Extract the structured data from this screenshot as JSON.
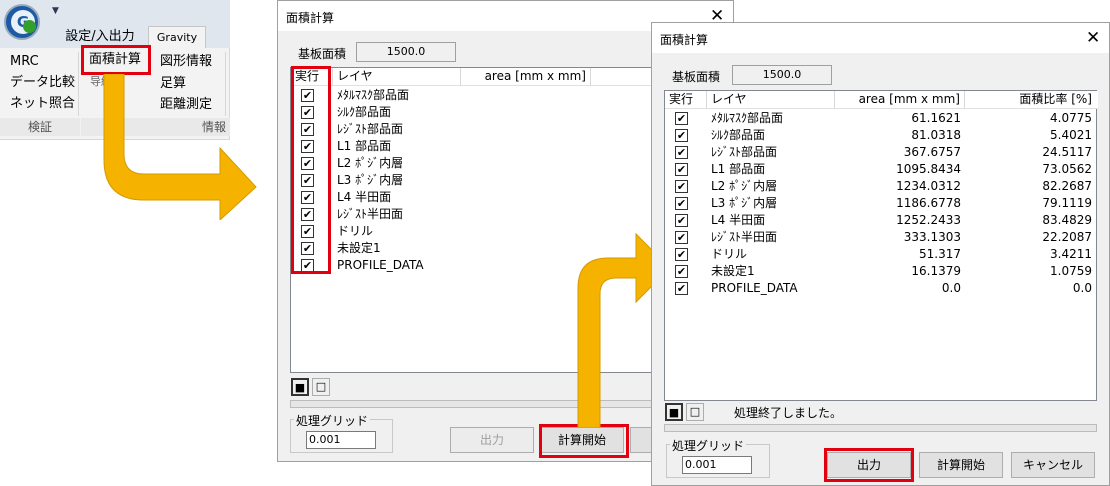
{
  "ribbon": {
    "tab_settings": "設定/入出力",
    "tab_gravity": "Gravity",
    "qa_glyph": "▼",
    "logo_letter": "G",
    "items": {
      "mrc": "MRC",
      "data_compare": "データ比較",
      "net_compare": "ネット照合",
      "area_calc": "面積計算",
      "misc": "导線 ▾",
      "shape_info": "図形情報",
      "sum": "足算",
      "distance": "距離測定"
    },
    "groups": {
      "verify": "検証",
      "info": "情報"
    }
  },
  "dialog1": {
    "title": "面積計算",
    "close": "✕",
    "substrate_label": "基板面積",
    "substrate_value": "1500.0",
    "columns": {
      "exec": "実行",
      "layer": "レイヤ",
      "area": "area [mm x mm]",
      "ratio": "面"
    },
    "rows": [
      {
        "label": "ﾒﾀﾙﾏｽｸ部品面"
      },
      {
        "label": "ｼﾙｸ部品面"
      },
      {
        "label": "ﾚｼﾞｽﾄ部品面"
      },
      {
        "label": "L1 部品面"
      },
      {
        "label": "L2 ﾎﾟｼﾞ内層"
      },
      {
        "label": "L3 ﾎﾟｼﾞ内層"
      },
      {
        "label": "L4 半田面"
      },
      {
        "label": "ﾚｼﾞｽﾄ半田面"
      },
      {
        "label": "ドリル"
      },
      {
        "label": "未設定1"
      },
      {
        "label": "PROFILE_DATA"
      }
    ],
    "check_mark": "✔",
    "grid_label": "処理グリッド",
    "grid_value": "0.001",
    "btn_output": "出力",
    "btn_start": "計算開始",
    "btn_cancel": "キ"
  },
  "dialog2": {
    "title": "面積計算",
    "close": "✕",
    "substrate_label": "基板面積",
    "substrate_value": "1500.0",
    "columns": {
      "exec": "実行",
      "layer": "レイヤ",
      "area": "area [mm x mm]",
      "ratio": "面積比率 [%]"
    },
    "rows": [
      {
        "label": "ﾒﾀﾙﾏｽｸ部品面",
        "area": "61.1621",
        "ratio": "4.0775"
      },
      {
        "label": "ｼﾙｸ部品面",
        "area": "81.0318",
        "ratio": "5.4021"
      },
      {
        "label": "ﾚｼﾞｽﾄ部品面",
        "area": "367.6757",
        "ratio": "24.5117"
      },
      {
        "label": "L1 部品面",
        "area": "1095.8434",
        "ratio": "73.0562"
      },
      {
        "label": "L2 ﾎﾟｼﾞ内層",
        "area": "1234.0312",
        "ratio": "82.2687"
      },
      {
        "label": "L3 ﾎﾟｼﾞ内層",
        "area": "1186.6778",
        "ratio": "79.1119"
      },
      {
        "label": "L4 半田面",
        "area": "1252.2433",
        "ratio": "83.4829"
      },
      {
        "label": "ﾚｼﾞｽﾄ半田面",
        "area": "333.1303",
        "ratio": "22.2087"
      },
      {
        "label": "ドリル",
        "area": "51.317",
        "ratio": "3.4211"
      },
      {
        "label": "未設定1",
        "area": "16.1379",
        "ratio": "1.0759"
      },
      {
        "label": "PROFILE_DATA",
        "area": "0.0",
        "ratio": "0.0"
      }
    ],
    "check_mark": "✔",
    "status": "処理終了しました。",
    "grid_label": "処理グリッド",
    "grid_value": "0.001",
    "btn_output": "出力",
    "btn_start": "計算開始",
    "btn_cancel": "キャンセル"
  },
  "toolbar_glyphs": {
    "all": "■",
    "none": "□"
  },
  "colors": {
    "highlight": "#e2000f",
    "arrow": "#f5b300",
    "arrow_edge": "#d49a00"
  }
}
